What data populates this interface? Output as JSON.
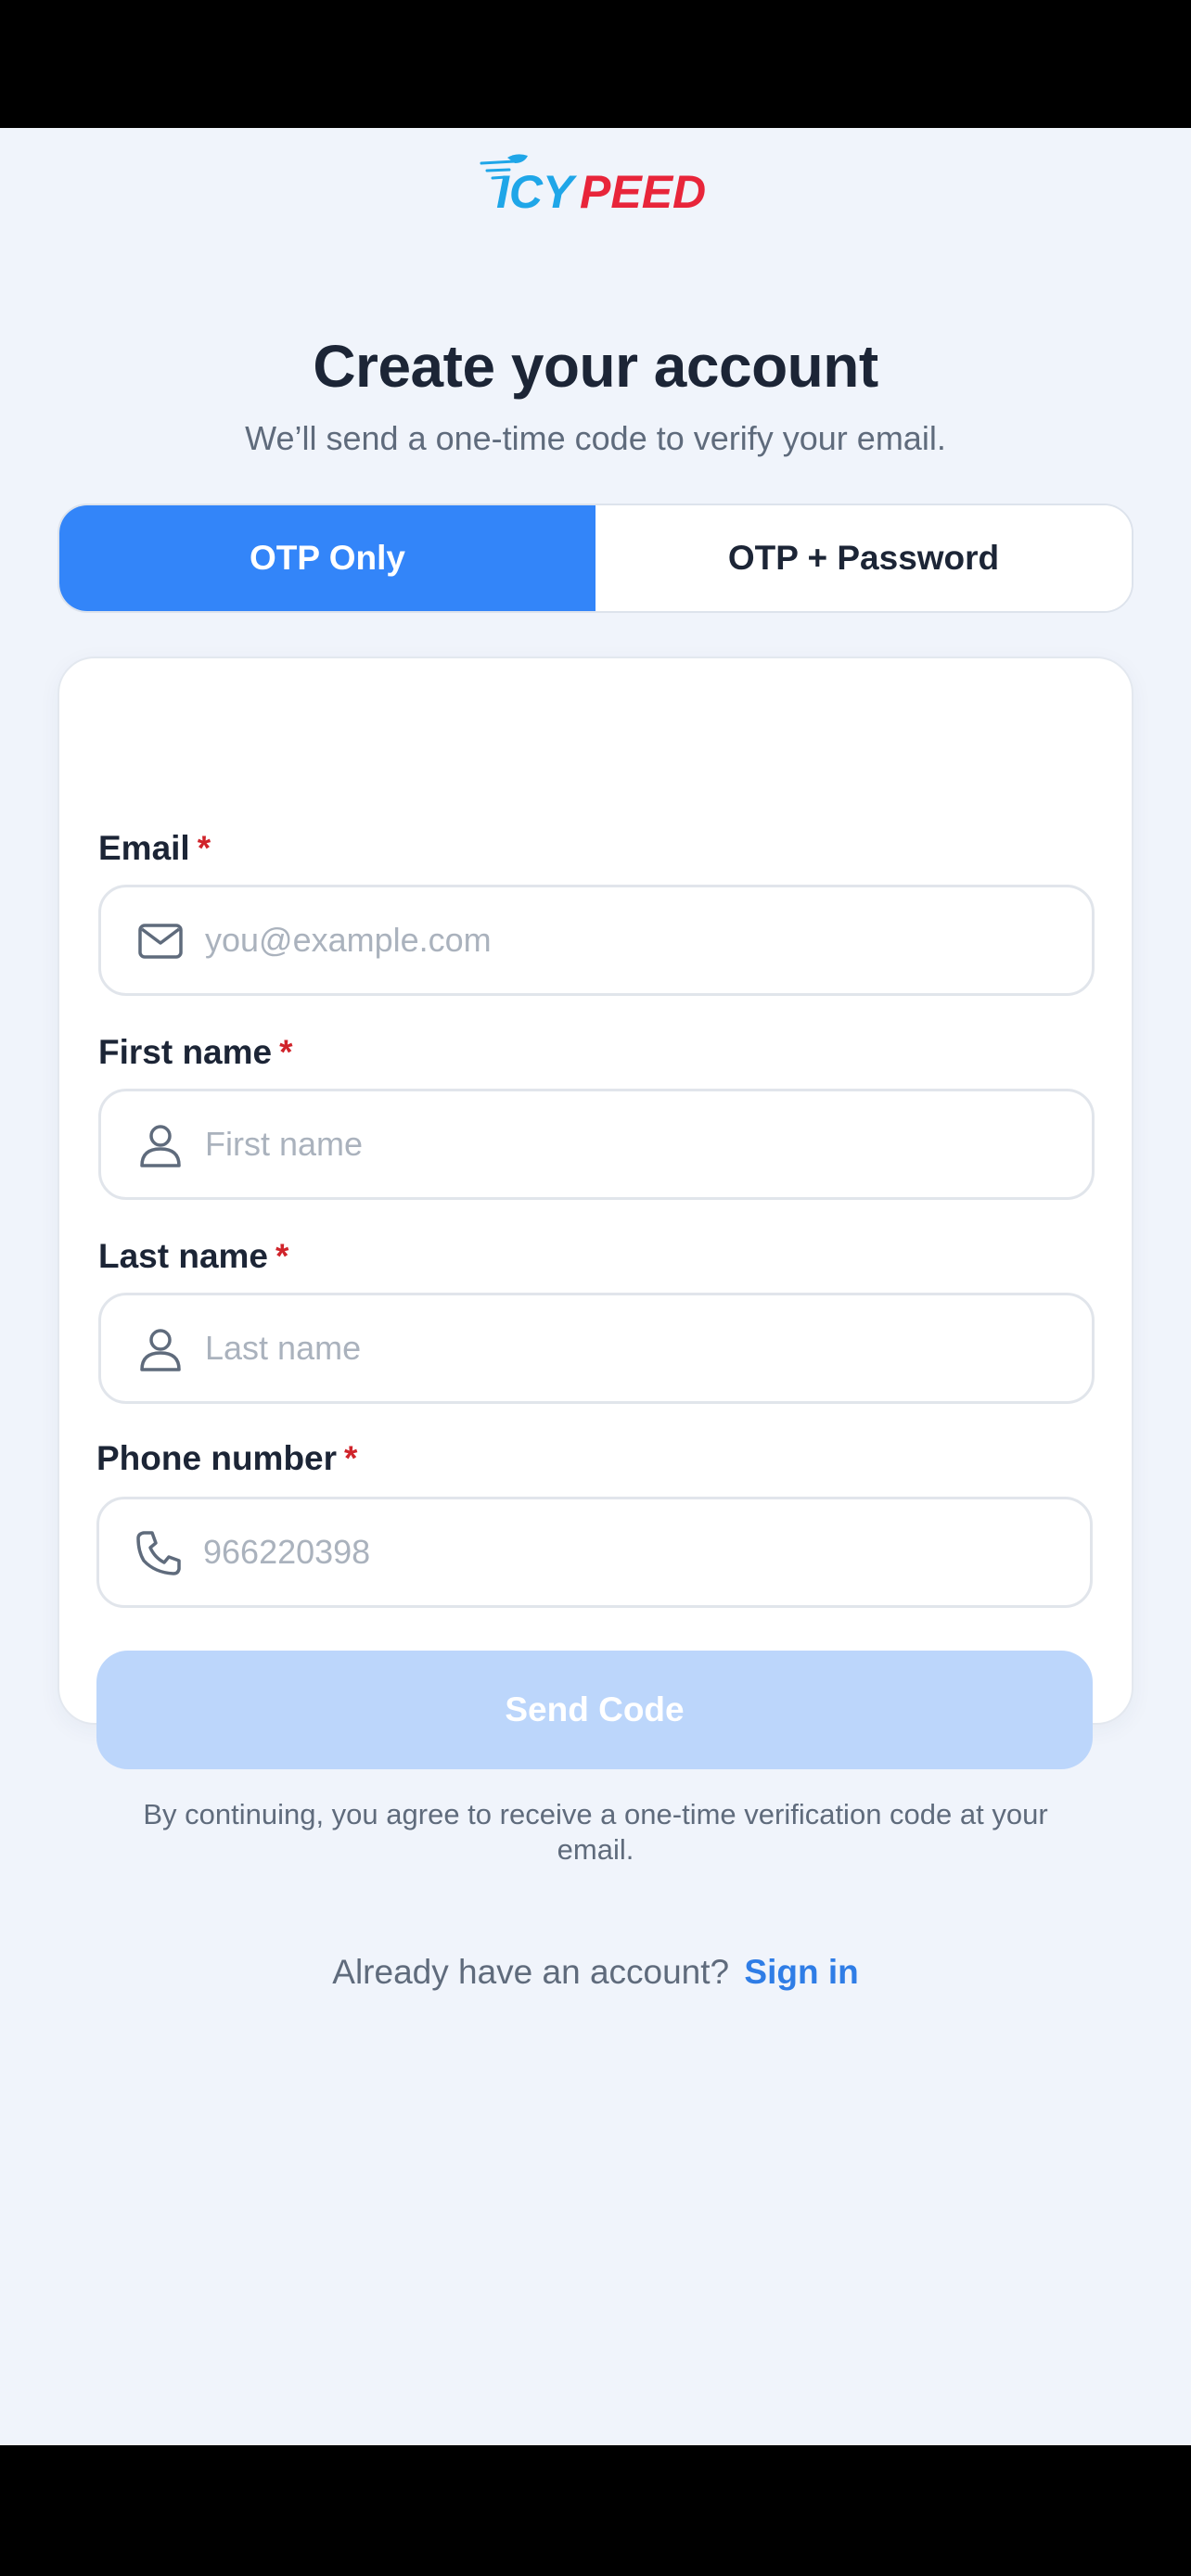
{
  "brand": {
    "logo_text_part1": "ICY",
    "logo_text_part2": "PEED",
    "colors": {
      "logo_blue": "#1fa6e8",
      "logo_red": "#e8253a"
    }
  },
  "header": {
    "title": "Create your account",
    "subtitle": "We’ll send a one-time code to verify your email."
  },
  "mode_toggle": {
    "options": [
      {
        "label": "OTP Only",
        "selected": true
      },
      {
        "label": "OTP + Password",
        "selected": false
      }
    ],
    "active_color": "#3385f9"
  },
  "form": {
    "fields": [
      {
        "label": "Email",
        "required_mark": "*",
        "placeholder": "you@example.com",
        "value": "",
        "icon": "mail-icon"
      },
      {
        "label": "First name",
        "required_mark": "*",
        "placeholder": "First name",
        "value": "",
        "icon": "user-icon"
      },
      {
        "label": "Last name",
        "required_mark": "*",
        "placeholder": "Last name",
        "value": "",
        "icon": "user-icon"
      },
      {
        "label": "Phone number",
        "required_mark": "*",
        "placeholder": "966220398",
        "value": "",
        "icon": "phone-icon"
      }
    ],
    "submit_label": "Send Code",
    "submit_disabled_color": "#bcd6fb",
    "consent": "By continuing, you agree to receive a one-time verification code at your email."
  },
  "footer": {
    "prompt": "Already have an account?",
    "signin_label": "Sign in"
  }
}
